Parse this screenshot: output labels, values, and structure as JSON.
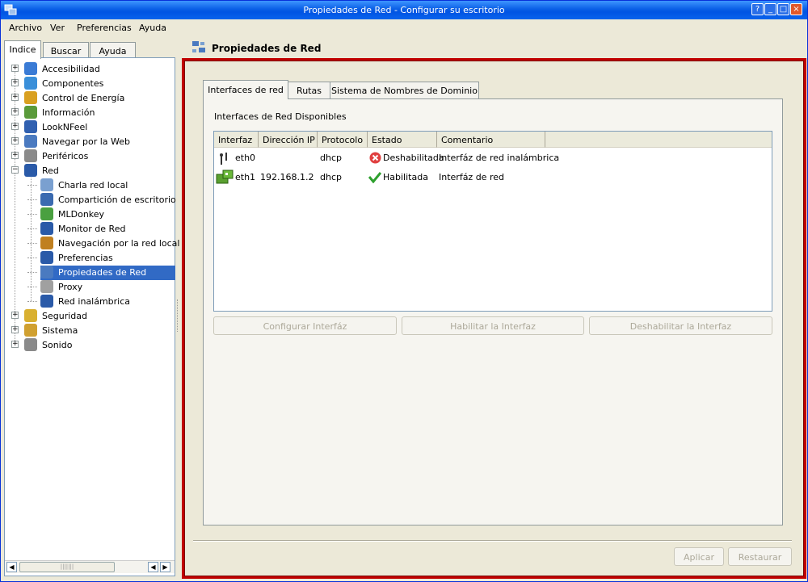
{
  "window": {
    "title": "Propiedades de Red - Configurar su escritorio",
    "controls": [
      "?",
      "_",
      "□",
      "×"
    ]
  },
  "menu": [
    {
      "label": "Archivo"
    },
    {
      "label": "Ver"
    },
    {
      "label": "Preferencias"
    },
    {
      "label": "Ayuda"
    }
  ],
  "left_tabs": [
    {
      "label": "Indice"
    },
    {
      "label": "Buscar"
    },
    {
      "label": "Ayuda"
    }
  ],
  "tree": {
    "top": [
      {
        "label": "Accesibilidad",
        "icon": "accessibility-icon",
        "color": "#3a7bd5"
      },
      {
        "label": "Componentes",
        "icon": "components-icon",
        "color": "#3a8fd9"
      },
      {
        "label": "Control de Energía",
        "icon": "power-icon",
        "color": "#d9a020"
      },
      {
        "label": "Información",
        "icon": "info-icon",
        "color": "#5a9a3a"
      },
      {
        "label": "LookNFeel",
        "icon": "appearance-icon",
        "color": "#3060b0"
      },
      {
        "label": "Navegar por la Web",
        "icon": "web-icon",
        "color": "#4a7ac0"
      },
      {
        "label": "Periféricos",
        "icon": "peripherals-icon",
        "color": "#8a8a8a"
      },
      {
        "label": "Red",
        "icon": "network-icon",
        "color": "#2a5aa8"
      }
    ],
    "red_children": [
      {
        "label": "Charla red local",
        "icon": "lan-chat-icon",
        "color": "#7aa0d0"
      },
      {
        "label": "Compartición de escritorio",
        "icon": "desktop-share-icon",
        "color": "#3a6ab0"
      },
      {
        "label": "MLDonkey",
        "icon": "mldonkey-icon",
        "color": "#4aa040"
      },
      {
        "label": "Monitor de Red",
        "icon": "network-monitor-icon",
        "color": "#2a5aa8"
      },
      {
        "label": "Navegación por la red local",
        "icon": "lan-browse-icon",
        "color": "#c08020"
      },
      {
        "label": "Preferencias",
        "icon": "preferences-icon",
        "color": "#2a5aa8"
      },
      {
        "label": "Propiedades de Red",
        "icon": "network-properties-icon",
        "color": "#4a7ac0",
        "selected": true
      },
      {
        "label": "Proxy",
        "icon": "proxy-icon",
        "color": "#a0a0a0"
      },
      {
        "label": "Red inalámbrica",
        "icon": "wireless-icon",
        "color": "#2a5aa8"
      }
    ],
    "bottom": [
      {
        "label": "Seguridad",
        "icon": "lock-icon",
        "color": "#d9b030"
      },
      {
        "label": "Sistema",
        "icon": "system-icon",
        "color": "#d0a030"
      },
      {
        "label": "Sonido",
        "icon": "sound-icon",
        "color": "#8a8a8a"
      }
    ]
  },
  "page": {
    "title": "Propiedades de Red",
    "tabs": [
      {
        "label": "Interfaces de red"
      },
      {
        "label": "Rutas"
      },
      {
        "label": "Sistema de Nombres de Dominio"
      }
    ],
    "group_label": "Interfaces de Red Disponibles",
    "columns": [
      "Interfaz",
      "Dirección IP",
      "Protocolo",
      "Estado",
      "Comentario"
    ],
    "rows": [
      {
        "iface": "eth0",
        "ip": "",
        "protocol": "dhcp",
        "state": "Deshabilitada",
        "comment": "Interfáz de red inalámbrica",
        "status": "disabled"
      },
      {
        "iface": "eth1",
        "ip": "192.168.1.2",
        "protocol": "dhcp",
        "state": "Habilitada",
        "comment": "Interfáz de red",
        "status": "enabled"
      }
    ],
    "buttons": {
      "configure": "Configurar Interfáz",
      "enable": "Habilitar la Interfaz",
      "disable": "Deshabilitar la Interfaz",
      "apply": "Aplicar",
      "restore": "Restaurar"
    }
  },
  "colors": {
    "accent_border": "#c00000",
    "selection": "#316ac5",
    "titlebar": "#0054e3"
  }
}
